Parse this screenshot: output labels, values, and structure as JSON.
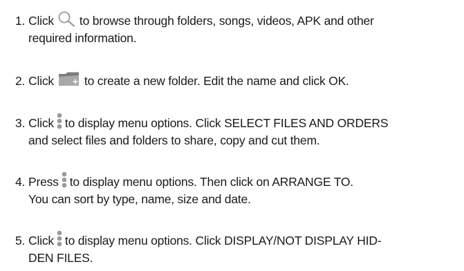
{
  "steps": [
    {
      "number": "1.",
      "line1_before": "Click",
      "icon": "search-icon",
      "line1_after": "to browse through folders, songs, videos, APK and other",
      "line2": "required information."
    },
    {
      "number": "2.",
      "line1_before": "Click",
      "icon": "new-folder-icon",
      "line1_after": "to create a new folder. Edit the name and click OK."
    },
    {
      "number": "3.",
      "line1_before": "Click",
      "icon": "menu-dots-icon",
      "line1_after": "to display menu options. Click SELECT FILES AND ORDERS",
      "line2": "and select files and folders to share, copy and cut them."
    },
    {
      "number": "4.",
      "line1_before": "Press",
      "icon": "menu-dots-icon",
      "line1_after": "to display menu options. Then click on ARRANGE TO.",
      "line2": "You can sort by type, name, size and date."
    },
    {
      "number": "5.",
      "line1_before": "Click",
      "icon": "menu-dots-icon",
      "line1_after": "to display menu options. Click DISPLAY/NOT DISPLAY HID-",
      "line2": "DEN FILES."
    }
  ],
  "colors": {
    "text": "#1a1a1a",
    "icon_gray": "#9a9a9a",
    "folder_dark": "#7b7b7b",
    "folder_light": "#a8a8a8"
  }
}
